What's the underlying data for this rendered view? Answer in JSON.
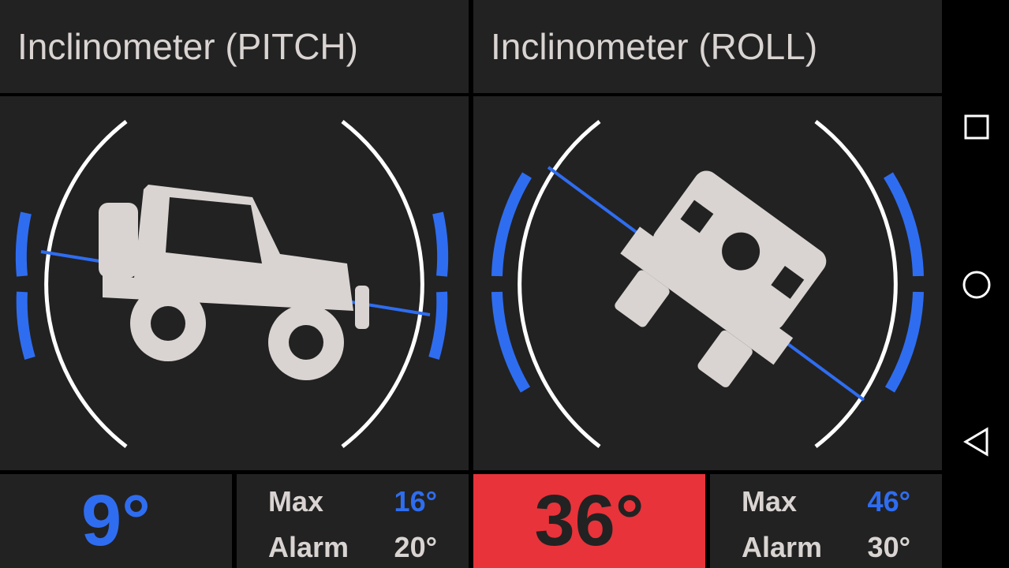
{
  "pitch": {
    "title": "Inclinometer (PITCH)",
    "value": "9°",
    "value_color": "#2f6df0",
    "value_bg": "#222222",
    "max_label": "Max",
    "max_value": "16°",
    "alarm_label": "Alarm",
    "alarm_value": "20°",
    "icon": "jeep-side-icon"
  },
  "roll": {
    "title": "Inclinometer (ROLL)",
    "value": "36°",
    "value_color": "#222222",
    "value_bg": "#e8333a",
    "max_label": "Max",
    "max_value": "46°",
    "alarm_label": "Alarm",
    "alarm_value": "30°",
    "icon": "jeep-rear-icon"
  },
  "navigation": {
    "recents": "square-icon",
    "home": "circle-icon",
    "back": "triangle-back-icon"
  },
  "colors": {
    "accent": "#2f6df0",
    "panel": "#222222",
    "alarm": "#e8333a",
    "vehicle": "#d9d4d2"
  }
}
